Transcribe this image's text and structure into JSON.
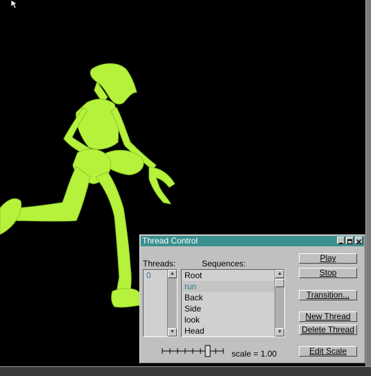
{
  "panel": {
    "title": "Thread Control",
    "threads_label": "Threads:",
    "sequences_label": "Sequences:",
    "threads": [
      "0"
    ],
    "sequences": [
      {
        "label": "Root",
        "selected": false
      },
      {
        "label": "run",
        "selected": true
      },
      {
        "label": "Back",
        "selected": false
      },
      {
        "label": "Side",
        "selected": false
      },
      {
        "label": "look",
        "selected": false
      },
      {
        "label": "Head",
        "selected": false
      }
    ],
    "buttons": {
      "play": "Play",
      "stop": "Stop",
      "transition": "Transition...",
      "new_thread": "New Thread",
      "delete_thread": "Delete Thread",
      "edit_scale": "Edit Scale"
    },
    "scale_text": "scale = 1.00",
    "scale_value": 1.0
  },
  "colors": {
    "titlebar": "#3a8f8f",
    "figure": "#b6f23c",
    "selected_text": "#2c7c8c"
  }
}
